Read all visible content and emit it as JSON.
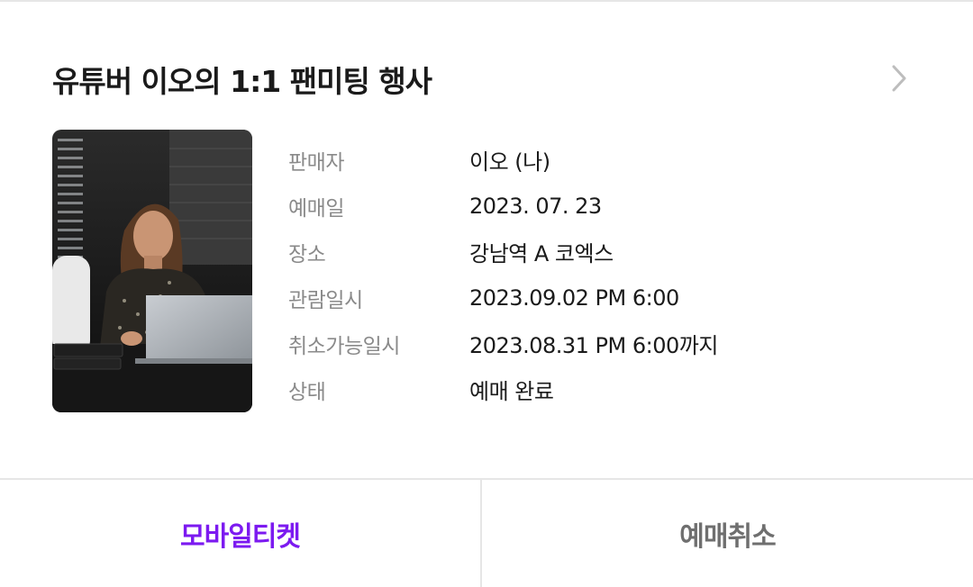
{
  "event": {
    "title": "유튜버 이오의 1:1 팬미팅 행사",
    "photo_alt": "",
    "details": [
      {
        "label": "판매자",
        "value": "이오 (나)"
      },
      {
        "label": "예매일",
        "value": "2023. 07. 23"
      },
      {
        "label": "장소",
        "value": "강남역 A 코엑스"
      },
      {
        "label": "관람일시",
        "value": "2023.09.02 PM 6:00"
      },
      {
        "label": "취소가능일시",
        "value": "2023.08.31 PM 6:00까지"
      },
      {
        "label": "상태",
        "value": "예매 완료"
      }
    ]
  },
  "actions": {
    "mobile_ticket": "모바일티켓",
    "cancel_booking": "예매취소"
  },
  "colors": {
    "accent": "#7c1af0",
    "secondary_button": "#6f6f6f",
    "label": "#8a8a8a",
    "divider": "#e6e6e6"
  },
  "icons": {
    "detail_arrow": "chevron-right-icon"
  }
}
